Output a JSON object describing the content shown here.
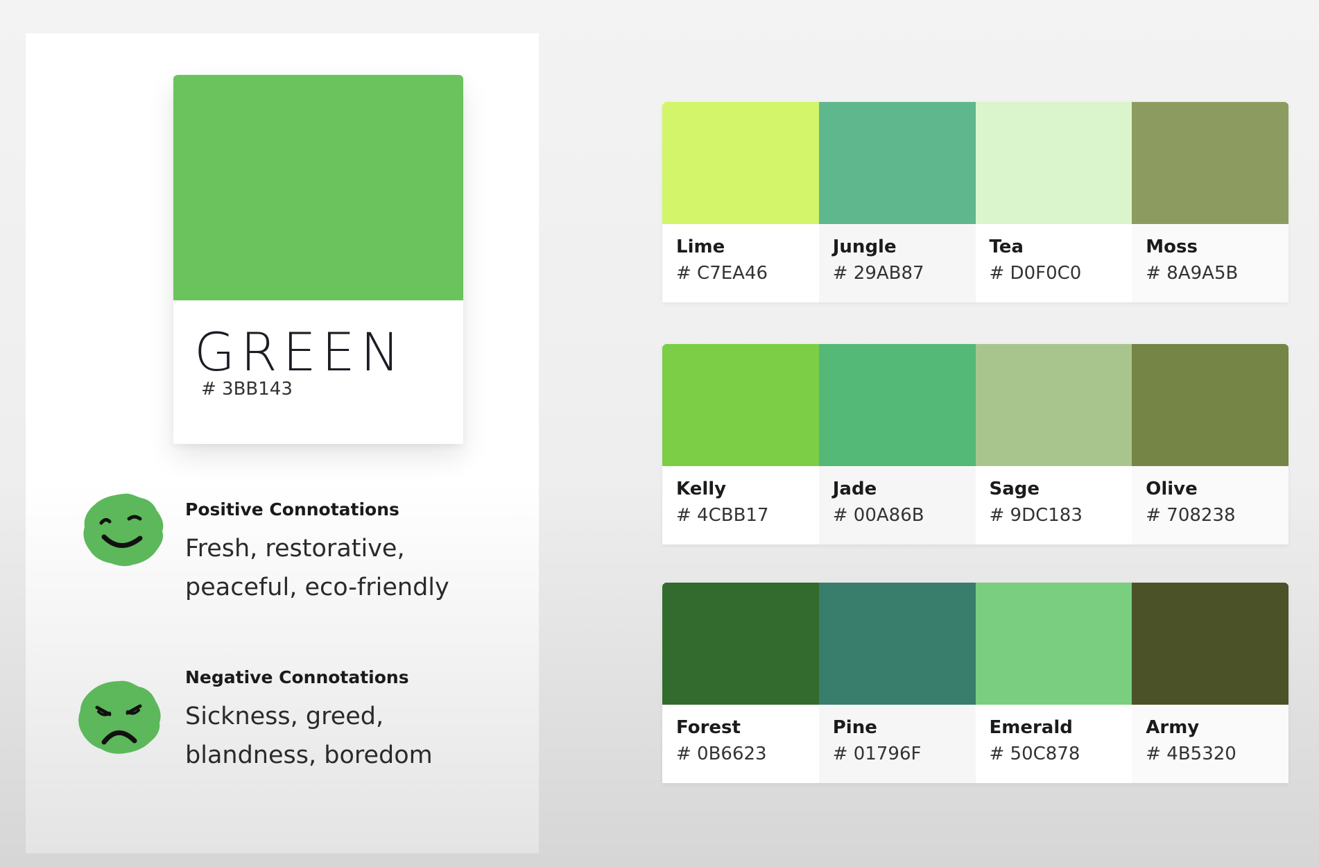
{
  "main": {
    "name": "GREEN",
    "hex": "# 3BB143",
    "color": "#6AC35C"
  },
  "positive": {
    "title": "Positive Connotations",
    "line1": "Fresh, restorative,",
    "line2": "peaceful, eco-friendly",
    "icon": "happy-face-icon",
    "color": "#5CB85A"
  },
  "negative": {
    "title": "Negative Connotations",
    "line1": "Sickness, greed,",
    "line2": "blandness, boredom",
    "icon": "sad-face-icon",
    "color": "#5CB85A"
  },
  "palettes": [
    [
      {
        "name": "Lime",
        "hex": "# C7EA46",
        "color": "#D2F56A"
      },
      {
        "name": "Jungle",
        "hex": "# 29AB87",
        "color": "#5FB78E"
      },
      {
        "name": "Tea",
        "hex": "# D0F0C0",
        "color": "#DAF5CC"
      },
      {
        "name": "Moss",
        "hex": "# 8A9A5B",
        "color": "#8C9C61"
      }
    ],
    [
      {
        "name": "Kelly",
        "hex": "# 4CBB17",
        "color": "#7BCE45"
      },
      {
        "name": "Jade",
        "hex": "# 00A86B",
        "color": "#54B876"
      },
      {
        "name": "Sage",
        "hex": "# 9DC183",
        "color": "#A8C58D"
      },
      {
        "name": "Olive",
        "hex": "# 708238",
        "color": "#748545"
      }
    ],
    [
      {
        "name": "Forest",
        "hex": "# 0B6623",
        "color": "#336B2E"
      },
      {
        "name": "Pine",
        "hex": "# 01796F",
        "color": "#397E6C"
      },
      {
        "name": "Emerald",
        "hex": "# 50C878",
        "color": "#79CE80"
      },
      {
        "name": "Army",
        "hex": "# 4B5320",
        "color": "#4B5228"
      }
    ]
  ]
}
